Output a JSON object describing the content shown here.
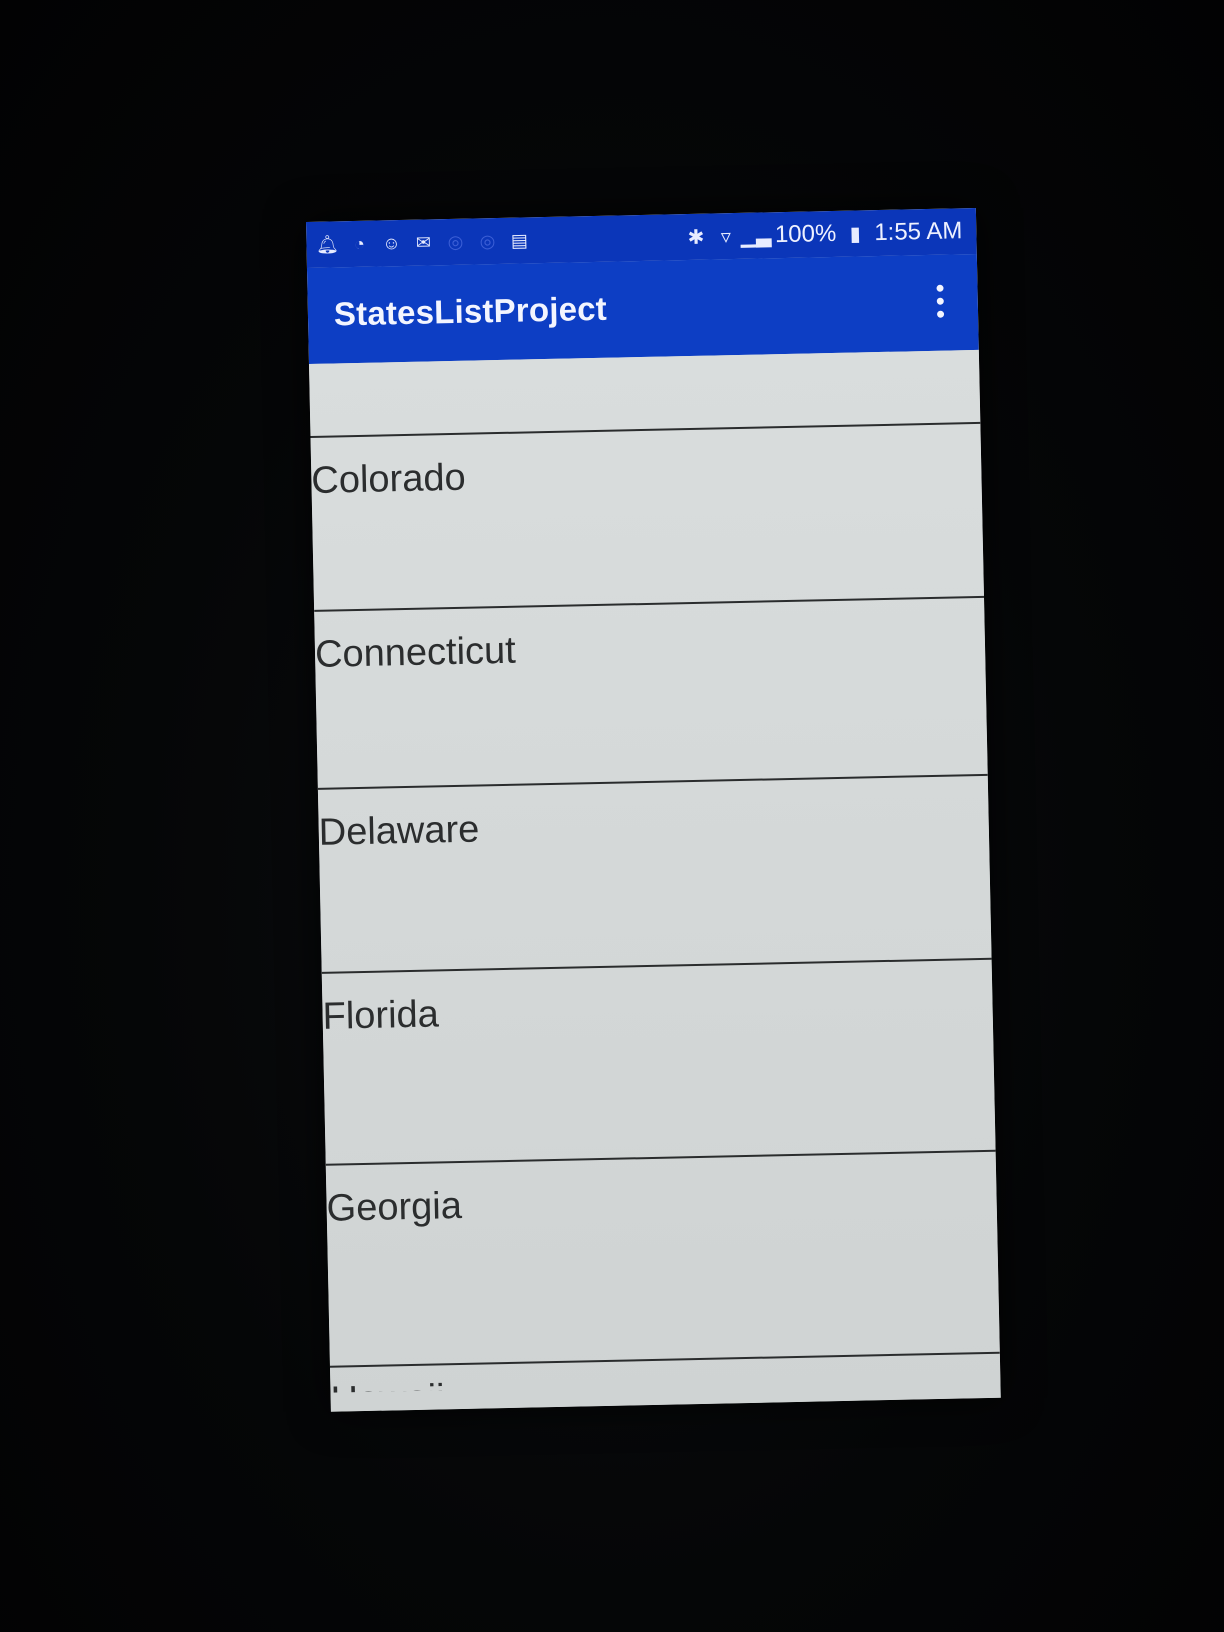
{
  "status_bar": {
    "battery_percent": "100%",
    "time": "1:55 AM",
    "left_icons": [
      "notification-bell-icon",
      "messenger-icon",
      "contact-icon",
      "email-icon",
      "sync-icon",
      "sync-icon",
      "sd-card-icon"
    ],
    "right_icons": [
      "bluetooth-icon",
      "wifi-icon",
      "signal-icon",
      "battery-icon"
    ]
  },
  "app_bar": {
    "title": "StatesListProject",
    "overflow_icon": "more-vert-icon"
  },
  "list": {
    "items": [
      {
        "label": "Colorado"
      },
      {
        "label": "Connecticut"
      },
      {
        "label": "Delaware"
      },
      {
        "label": "Florida"
      },
      {
        "label": "Georgia"
      },
      {
        "label": "Hawaii"
      }
    ]
  },
  "colors": {
    "status_bar": "#0b36b9",
    "app_bar": "#0d3ec4",
    "list_background": "#d7dbdb",
    "divider": "#2a2c2d",
    "text": "#2b2d2e"
  }
}
